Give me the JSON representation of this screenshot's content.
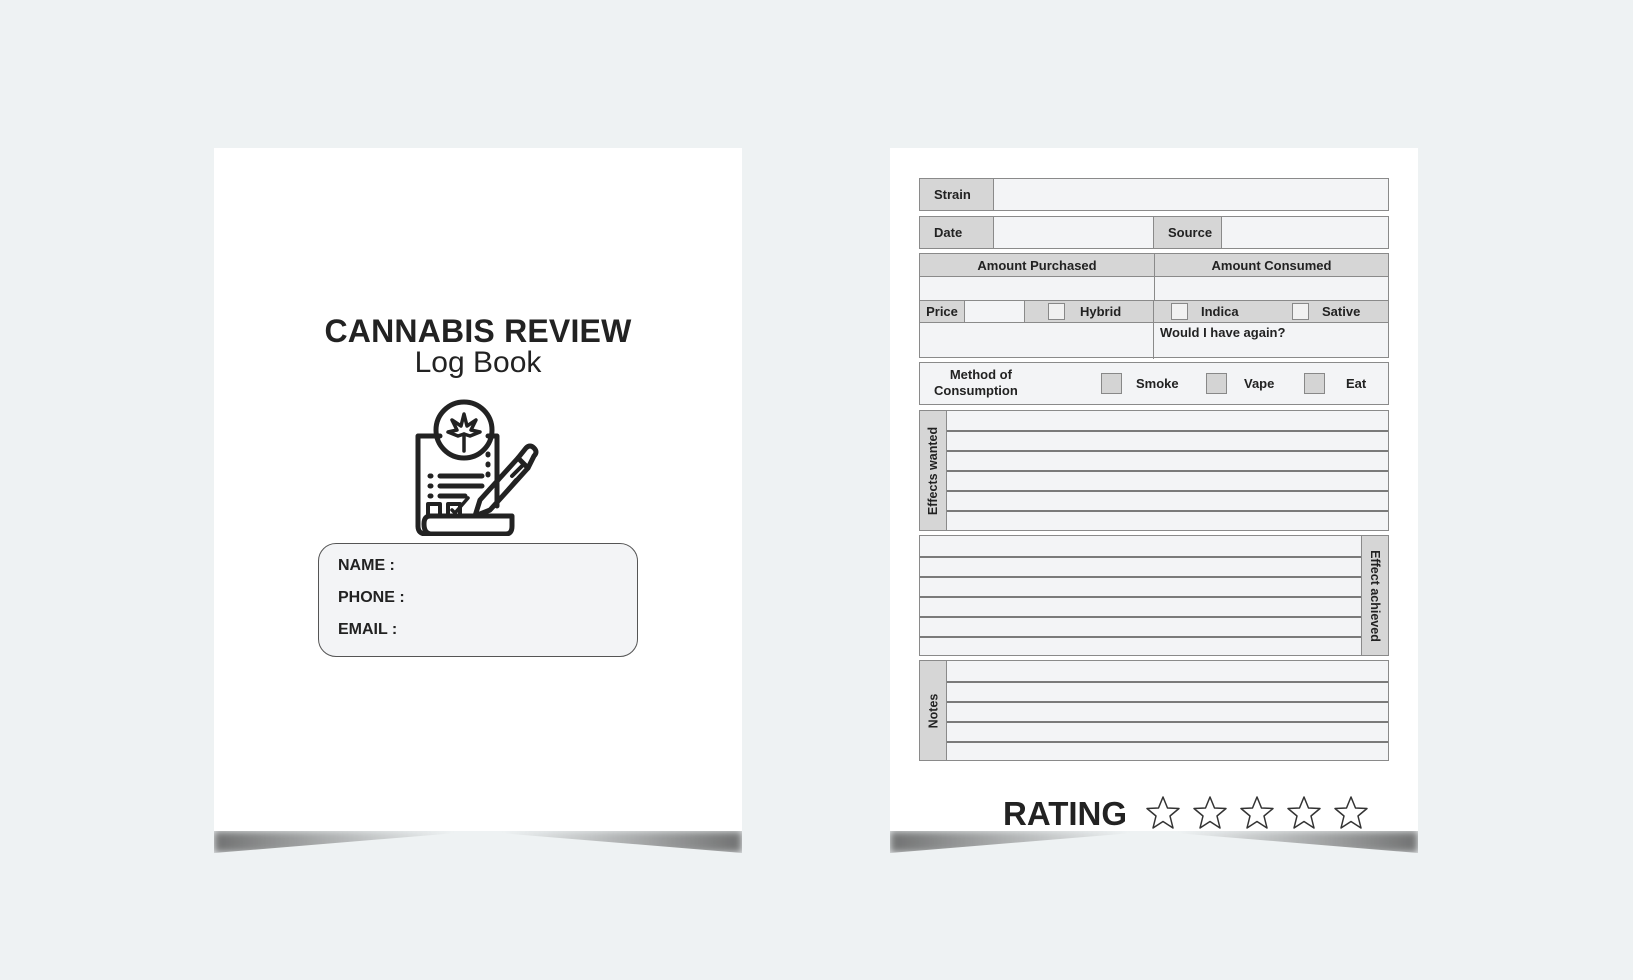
{
  "cover": {
    "title": "CANNABIS REVIEW",
    "subtitle": "Log Book",
    "icon": "cannabis-document-pen-icon",
    "info_fields": [
      "NAME :",
      "PHONE :",
      "EMAIL :"
    ]
  },
  "form": {
    "strain_label": "Strain",
    "date_label": "Date",
    "source_label": "Source",
    "amount_purchased_label": "Amount Purchased",
    "amount_consumed_label": "Amount Consumed",
    "price_label": "Price",
    "type_options": [
      "Hybrid",
      "Indica",
      "Sative"
    ],
    "would_have_again_label": "Would I have again?",
    "method_label_line1": "Method of",
    "method_label_line2": "Consumption",
    "method_options": [
      "Smoke",
      "Vape",
      "Eat"
    ],
    "effects_wanted_label": "Effects wanted",
    "effects_wanted_lines": 6,
    "effect_achieved_label": "Effect achieved",
    "effect_achieved_lines": 6,
    "notes_label": "Notes",
    "notes_lines": 5,
    "rating_label": "RATING",
    "rating_stars_total": 5,
    "rating_stars_filled": 0
  },
  "colors": {
    "background": "#eef2f3",
    "page": "#ffffff",
    "label_fill": "#d6d6d6",
    "field_fill": "#f3f4f6",
    "border": "#8a8a8a",
    "text": "#222222"
  }
}
